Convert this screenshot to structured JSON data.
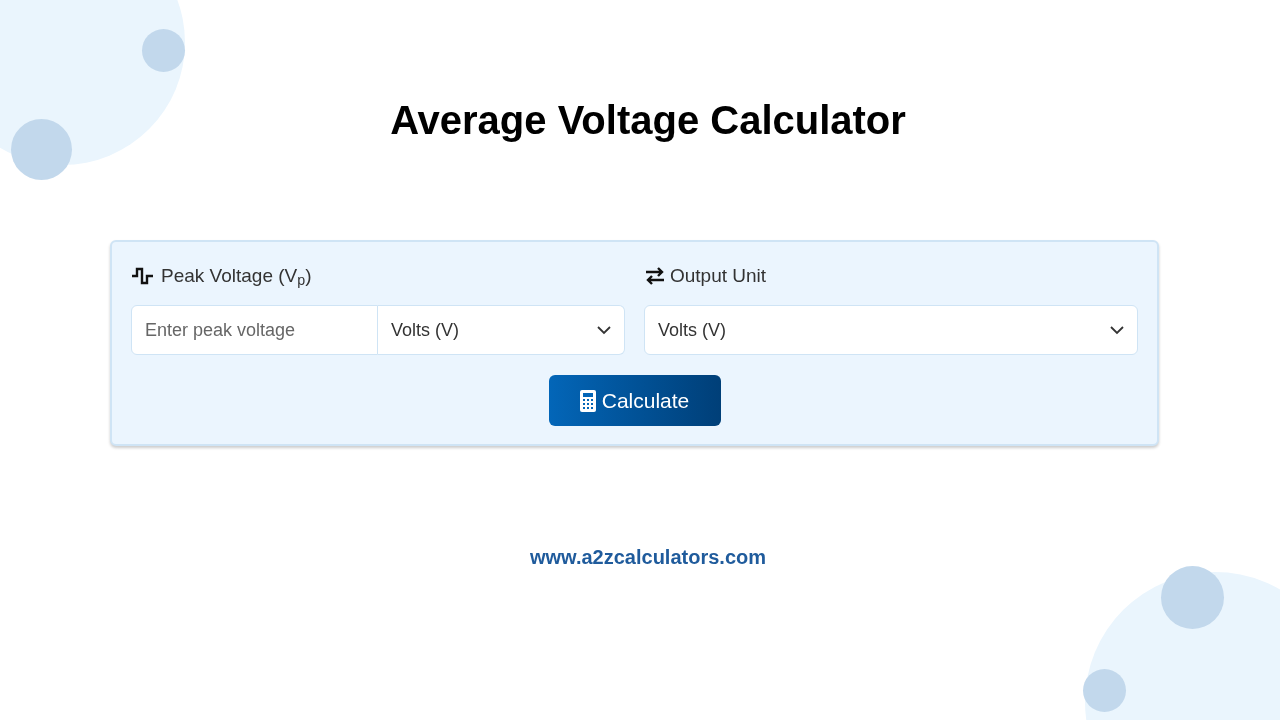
{
  "title": "Average Voltage Calculator",
  "peak_voltage": {
    "label": "Peak Voltage (V$_{p}$)",
    "placeholder": "Enter peak voltage",
    "unit": "Volts (V)"
  },
  "output_unit": {
    "label": "Output Unit",
    "value": "Volts (V)"
  },
  "button": "Calculate",
  "footer": "www.a2zcalculators.com"
}
